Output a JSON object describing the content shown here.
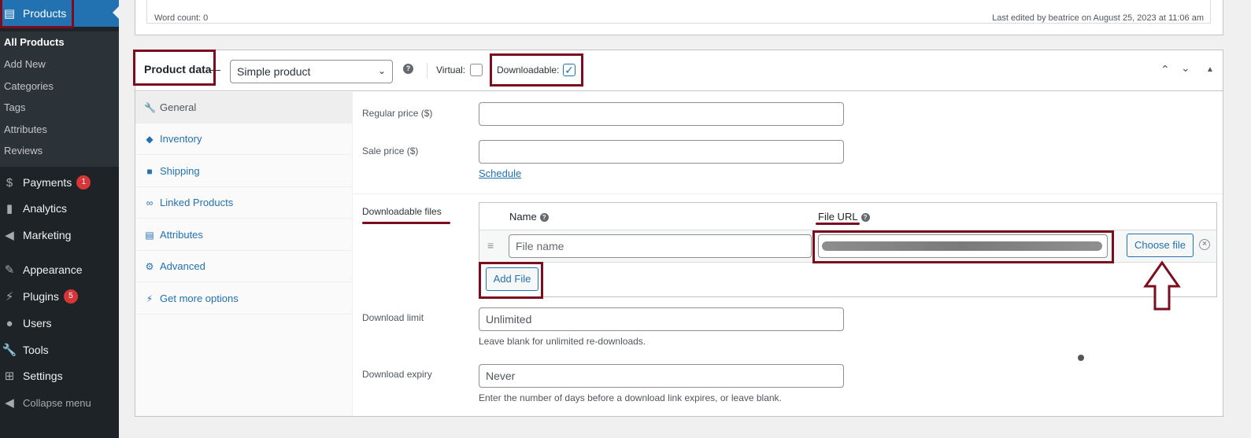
{
  "sidebar": {
    "current": {
      "label": "Products",
      "icon": "products-icon"
    },
    "submenu": [
      "All Products",
      "Add New",
      "Categories",
      "Tags",
      "Attributes",
      "Reviews"
    ],
    "items": [
      {
        "label": "Payments",
        "badge": "1",
        "icon": "payments-icon"
      },
      {
        "label": "Analytics",
        "icon": "analytics-icon"
      },
      {
        "label": "Marketing",
        "icon": "marketing-icon"
      },
      {
        "label": "Appearance",
        "icon": "appearance-icon"
      },
      {
        "label": "Plugins",
        "badge": "5",
        "icon": "plugins-icon"
      },
      {
        "label": "Users",
        "icon": "users-icon"
      },
      {
        "label": "Tools",
        "icon": "tools-icon"
      },
      {
        "label": "Settings",
        "icon": "settings-icon"
      },
      {
        "label": "Collapse menu",
        "icon": "collapse-icon"
      }
    ]
  },
  "editor": {
    "word_count": "Word count: 0",
    "last_edited": "Last edited by beatrice on August 25, 2023 at 11:06 am"
  },
  "product_data": {
    "title": "Product data",
    "dash": "—",
    "type": "Simple product",
    "virtual_label": "Virtual:",
    "virtual_checked": false,
    "downloadable_label": "Downloadable:",
    "downloadable_checked": true
  },
  "tabs": [
    {
      "label": "General",
      "icon": "wrench-icon",
      "active": true
    },
    {
      "label": "Inventory",
      "icon": "tag-icon"
    },
    {
      "label": "Shipping",
      "icon": "truck-icon"
    },
    {
      "label": "Linked Products",
      "icon": "link-icon"
    },
    {
      "label": "Attributes",
      "icon": "list-icon"
    },
    {
      "label": "Advanced",
      "icon": "gear-icon"
    },
    {
      "label": "Get more options",
      "icon": "plug-icon"
    }
  ],
  "general": {
    "regular_price_label": "Regular price ($)",
    "sale_price_label": "Sale price ($)",
    "schedule_link": "Schedule",
    "downloadable_files_label": "Downloadable files",
    "name_header": "Name",
    "file_url_header": "File URL",
    "file_name_placeholder": "File name",
    "choose_file": "Choose file",
    "add_file": "Add File",
    "download_limit_label": "Download limit",
    "download_limit_placeholder": "Unlimited",
    "download_limit_desc": "Leave blank for unlimited re-downloads.",
    "download_expiry_label": "Download expiry",
    "download_expiry_placeholder": "Never",
    "download_expiry_desc": "Enter the number of days before a download link expires, or leave blank."
  },
  "colors": {
    "annotation": "#7b0d1e",
    "wp_blue": "#2271b1",
    "sidebar_bg": "#1d2327"
  }
}
